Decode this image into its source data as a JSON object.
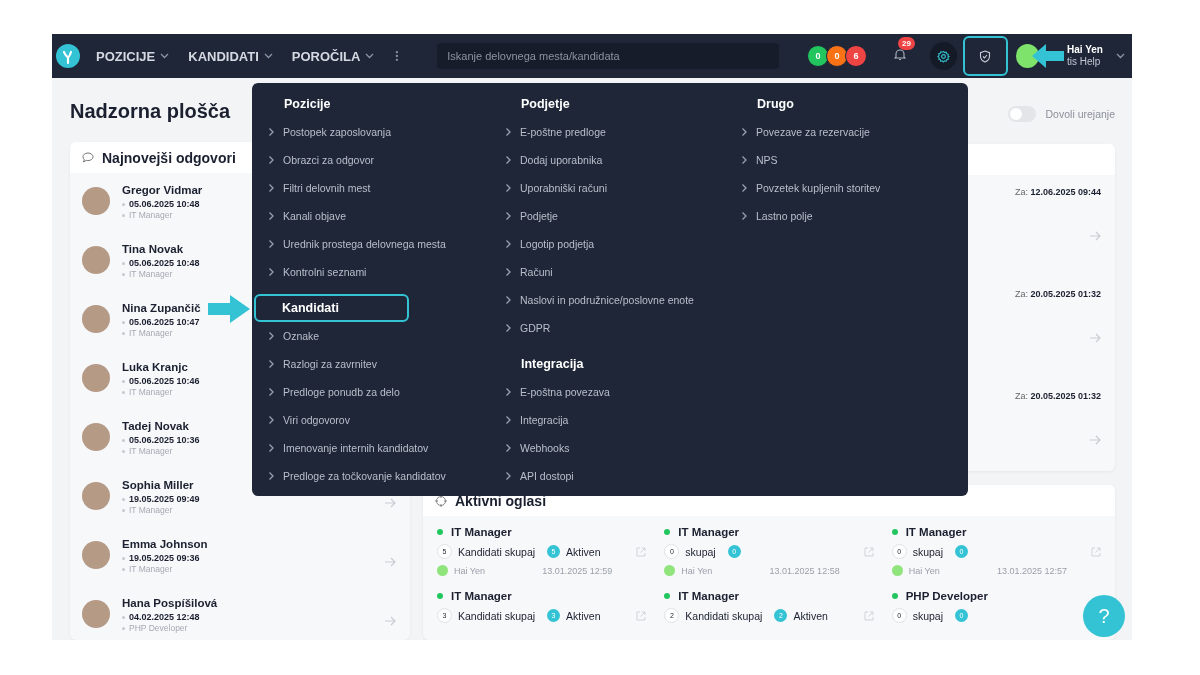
{
  "nav": {
    "menus": [
      "POZICIJE",
      "KANDIDATI",
      "POROČILA"
    ],
    "search": {
      "placeholder": "Iskanje delovnega mesta/kandidata"
    },
    "status_counts": [
      {
        "value": "0",
        "color": "#22c55e"
      },
      {
        "value": "0",
        "color": "#f97316"
      },
      {
        "value": "6",
        "color": "#ef4444"
      }
    ],
    "notifications": {
      "count": "29"
    },
    "shield_button": {
      "highlighted": true
    },
    "user": {
      "name": "Hai Yen",
      "subtitle": "tis Help"
    }
  },
  "page_title": "Nadzorna plošča",
  "edit_toggle": {
    "label": "Dovoli urejanje",
    "on": false
  },
  "responses": {
    "title": "Najnovejši odgovori",
    "items": [
      {
        "name": "Gregor Vidmar",
        "date": "05.06.2025 10:48",
        "position": "IT Manager"
      },
      {
        "name": "Tina Novak",
        "date": "05.06.2025 10:48",
        "position": "IT Manager"
      },
      {
        "name": "Nina Zupančič",
        "date": "05.06.2025 10:47",
        "position": "IT Manager"
      },
      {
        "name": "Luka Kranjc",
        "date": "05.06.2025 10:46",
        "position": "IT Manager"
      },
      {
        "name": "Tadej Novak",
        "date": "05.06.2025 10:36",
        "position": "IT Manager"
      },
      {
        "name": "Sophia Miller",
        "date": "19.05.2025 09:49",
        "position": "IT Manager"
      },
      {
        "name": "Emma Johnson",
        "date": "19.05.2025 09:36",
        "position": "IT Manager"
      },
      {
        "name": "Hana Pospíšilová",
        "date": "04.02.2025 12:48",
        "position": "PHP Developer"
      }
    ]
  },
  "upcoming": {
    "items": [
      {
        "label": "Za:",
        "date": "12.06.2025 09:44"
      },
      {
        "label": "Za:",
        "date": "20.05.2025 01:32"
      },
      {
        "label": "Za:",
        "date": "20.05.2025 01:32"
      }
    ]
  },
  "active_ads": {
    "title": "Aktivni oglasi",
    "items": [
      {
        "title": "IT Manager",
        "candidates": "5",
        "candidates_label": "Kandidati skupaj",
        "active": "5",
        "active_label": "Aktiven",
        "owner": "Hai Yen",
        "date": "13.01.2025 12:59"
      },
      {
        "title": "IT Manager",
        "candidates": "0",
        "candidates_label": "skupaj",
        "active": "0",
        "owner": "Hai Yen",
        "date": "13.01.2025 12:58"
      },
      {
        "title": "IT Manager",
        "candidates": "0",
        "candidates_label": "skupaj",
        "active": "0",
        "owner": "Hai Yen",
        "date": "13.01.2025 12:57"
      },
      {
        "title": "IT Manager",
        "candidates": "3",
        "candidates_label": "Kandidati skupaj",
        "active": "3",
        "active_label": "Aktiven"
      },
      {
        "title": "IT Manager",
        "candidates": "2",
        "candidates_label": "Kandidati skupaj",
        "active": "2",
        "active_label": "Aktiven"
      },
      {
        "title": "PHP Developer",
        "candidates": "0",
        "candidates_label": "skupaj",
        "active": "0"
      }
    ]
  },
  "menu": {
    "columns": [
      [
        {
          "title": "Pozicije",
          "highlighted": false,
          "items": [
            "Postopek zaposlovanja",
            "Obrazci za odgovor",
            "Filtri delovnih mest",
            "Kanali objave",
            "Urednik prostega delovnega mesta",
            "Kontrolni seznami"
          ]
        },
        {
          "title": "Kandidati",
          "highlighted": true,
          "items": [
            "Oznake",
            "Razlogi za zavrnitev",
            "Predloge ponudb za delo",
            "Viri odgovorov",
            "Imenovanje internih kandidatov",
            "Predloge za točkovanje kandidatov"
          ]
        }
      ],
      [
        {
          "title": "Podjetje",
          "highlighted": false,
          "items": [
            "E-poštne predloge",
            "Dodaj uporabnika",
            "Uporabniški računi",
            "Podjetje",
            "Logotip podjetja",
            "Računi",
            "Naslovi in podružnice/poslovne enote",
            "GDPR"
          ]
        },
        {
          "title": "Integracija",
          "highlighted": false,
          "items": [
            "E-poštna povezava",
            "Integracija",
            "Webhooks",
            "API dostopi"
          ]
        }
      ],
      [
        {
          "title": "Drugo",
          "highlighted": false,
          "items": [
            "Povezave za rezervacije",
            "NPS",
            "Povzetek kupljenih storitev",
            "Lastno polje"
          ]
        }
      ]
    ]
  },
  "help_button": {
    "label": "?"
  }
}
